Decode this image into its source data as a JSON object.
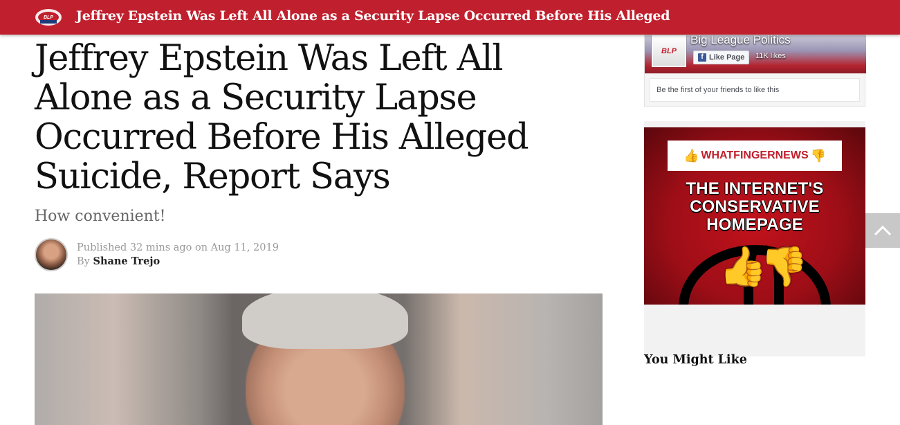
{
  "topbar": {
    "logo_icon": "big-league-politics-logo",
    "title": "Jeffrey Epstein Was Left All Alone as a Security Lapse Occurred Before His Alleged"
  },
  "article": {
    "headline": "Jeffrey Epstein Was Left All Alone as a Security Lapse Occurred Before His Alleged Suicide, Report Says",
    "subtitle": "How convenient!",
    "published_label": "Published",
    "published_time": "32 mins ago on Aug 11, 2019",
    "by_label": "By",
    "author": "Shane Trejo"
  },
  "sidebar": {
    "facebook": {
      "page_name": "Big League Politics",
      "like_button": "Like Page",
      "likes": "11K likes",
      "friends_text": "Be the first of your friends to like this"
    },
    "ad": {
      "brand_left": "WHATFINGER",
      "brand_right": "NEWS",
      "headline_lines": [
        "THE INTERNET'S",
        "CONSERVATIVE",
        "HOMEPAGE"
      ]
    },
    "you_might_like": "You Might Like"
  },
  "colors": {
    "brand_red": "#c0202e",
    "facebook_blue": "#3b5998"
  }
}
